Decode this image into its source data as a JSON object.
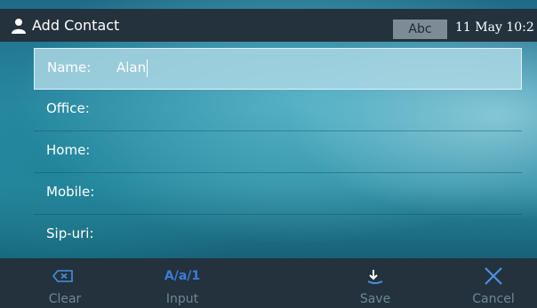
{
  "header": {
    "title": "Add Contact",
    "input_mode": "Abc",
    "datetime": "11 May 10:2"
  },
  "form": {
    "fields": [
      {
        "label": "Name:",
        "value": "Alan",
        "active": true
      },
      {
        "label": "Office:",
        "value": ""
      },
      {
        "label": "Home:",
        "value": ""
      },
      {
        "label": "Mobile:",
        "value": ""
      },
      {
        "label": "Sip-uri:",
        "value": ""
      }
    ]
  },
  "softkeys": {
    "clear": {
      "label": "Clear",
      "icon": "backspace-x-icon"
    },
    "input": {
      "label": "Input",
      "glyph": "A/a/1"
    },
    "save": {
      "label": "Save",
      "icon": "save-download-icon"
    },
    "cancel": {
      "label": "Cancel",
      "icon": "close-x-icon"
    }
  },
  "colors": {
    "bar_background": "#23323d",
    "softkey_text": "#6f8897",
    "input_glyph": "#3b7dd8",
    "icon_blue": "#4a90e2",
    "mode_badge": "#7d8b95"
  }
}
